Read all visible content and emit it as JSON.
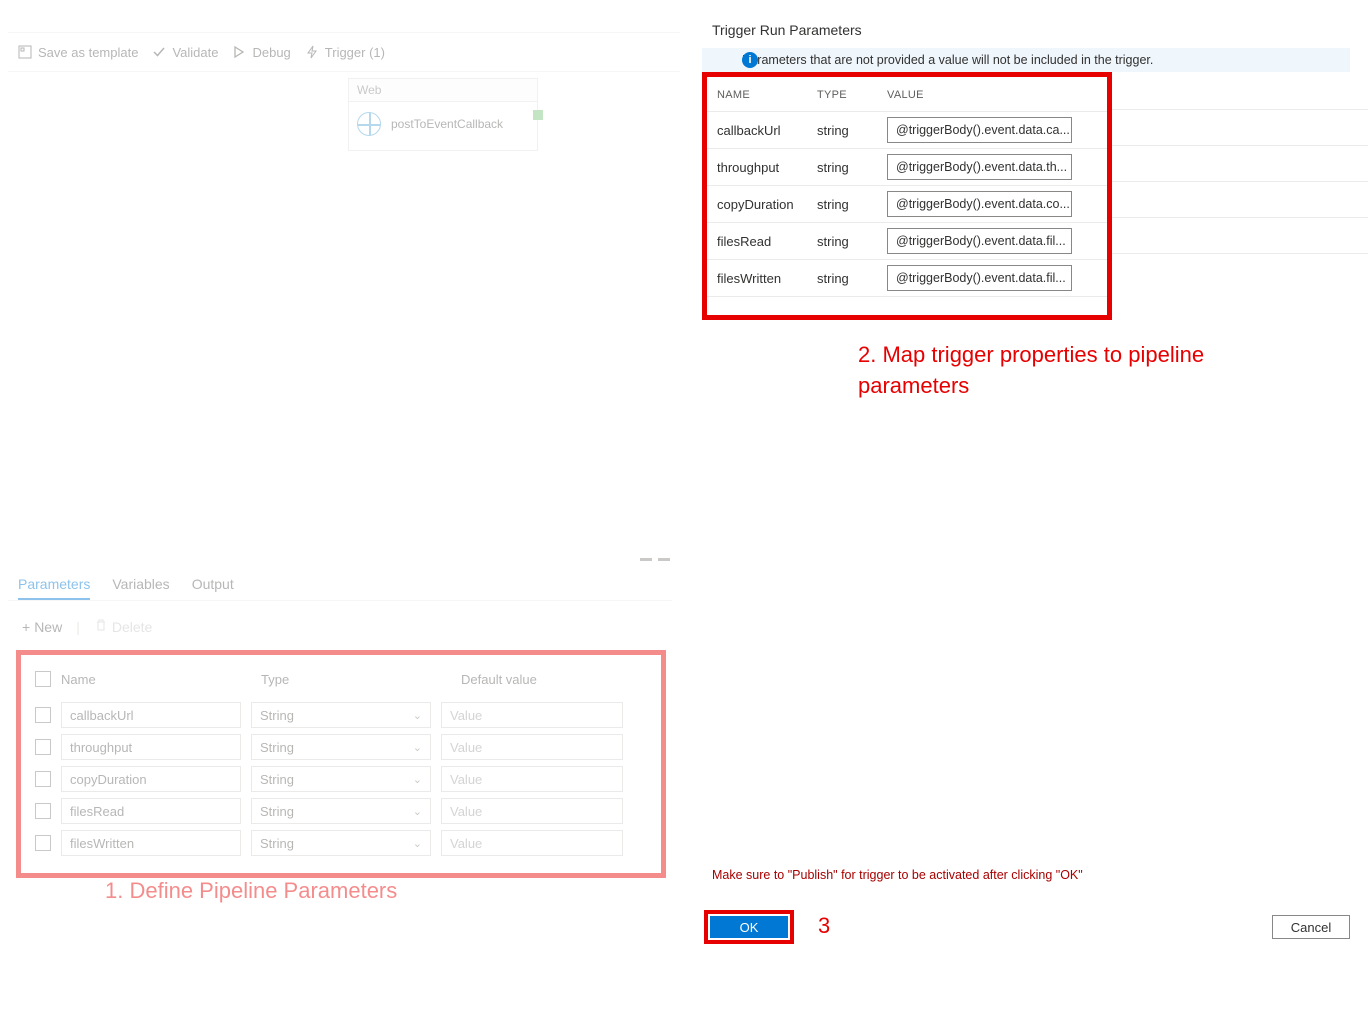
{
  "toolbar": {
    "save_template": "Save as template",
    "validate": "Validate",
    "debug": "Debug",
    "trigger": "Trigger (1)"
  },
  "activity": {
    "type_label": "Web",
    "name": "postToEventCallback"
  },
  "bottom_tabs": {
    "parameters": "Parameters",
    "variables": "Variables",
    "output": "Output"
  },
  "params_actions": {
    "new": "New",
    "delete": "Delete"
  },
  "params_headers": {
    "name": "Name",
    "type": "Type",
    "default": "Default value"
  },
  "pipeline_params": [
    {
      "name": "callbackUrl",
      "type": "String",
      "placeholder": "Value"
    },
    {
      "name": "throughput",
      "type": "String",
      "placeholder": "Value"
    },
    {
      "name": "copyDuration",
      "type": "String",
      "placeholder": "Value"
    },
    {
      "name": "filesRead",
      "type": "String",
      "placeholder": "Value"
    },
    {
      "name": "filesWritten",
      "type": "String",
      "placeholder": "Value"
    }
  ],
  "right": {
    "title": "Trigger Run Parameters",
    "info": "Parameters that are not provided a value will not be included in the trigger.",
    "headers": {
      "name": "NAME",
      "type": "TYPE",
      "value": "VALUE"
    },
    "rows": [
      {
        "name": "callbackUrl",
        "type": "string",
        "value": "@triggerBody().event.data.ca..."
      },
      {
        "name": "throughput",
        "type": "string",
        "value": "@triggerBody().event.data.th..."
      },
      {
        "name": "copyDuration",
        "type": "string",
        "value": "@triggerBody().event.data.co..."
      },
      {
        "name": "filesRead",
        "type": "string",
        "value": "@triggerBody().event.data.fil..."
      },
      {
        "name": "filesWritten",
        "type": "string",
        "value": "@triggerBody().event.data.fil..."
      }
    ],
    "publish_note": "Make sure to \"Publish\" for trigger to be activated after clicking \"OK\"",
    "ok": "OK",
    "cancel": "Cancel"
  },
  "annotations": {
    "a1": "1. Define Pipeline Parameters",
    "a2": "2. Map trigger properties to pipeline parameters",
    "a3": "3"
  }
}
